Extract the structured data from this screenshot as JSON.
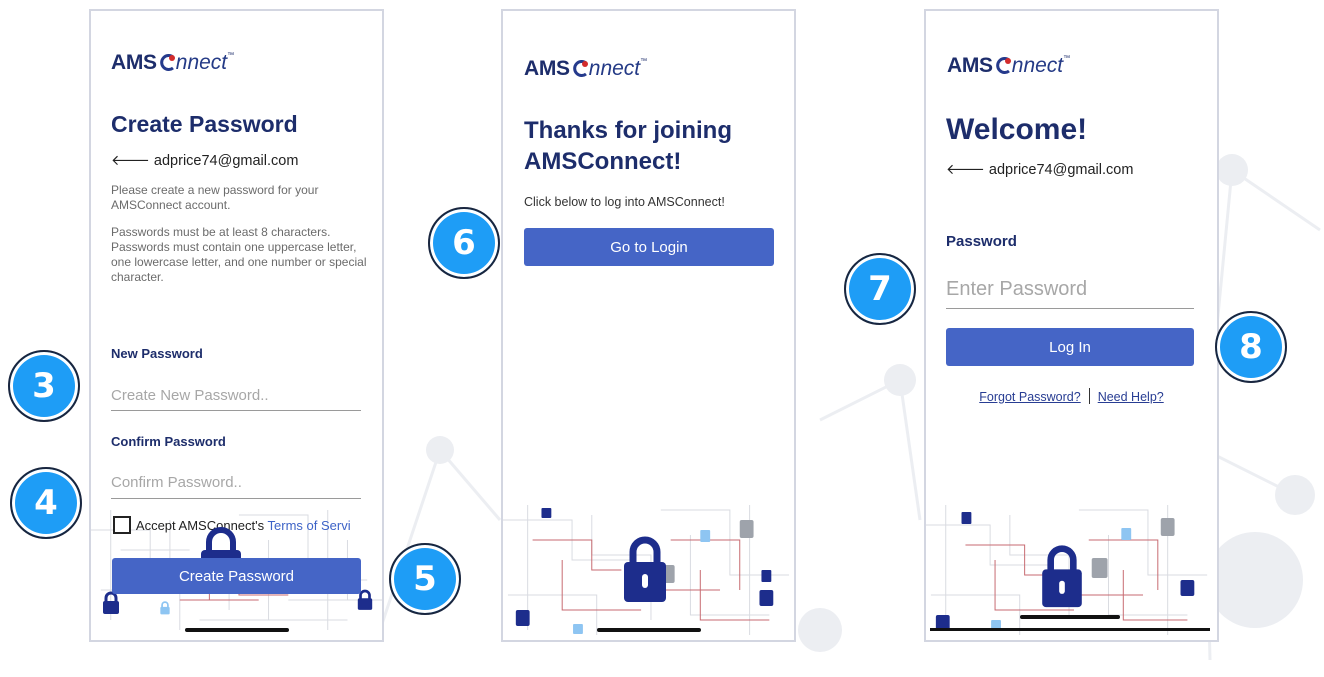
{
  "brand": {
    "bold": "AMS",
    "light": "nnect",
    "tm": "™"
  },
  "colors": {
    "primary_button": "#4565c6",
    "badge": "#1e9df6",
    "title": "#1d2d6b",
    "lock_navy": "#1d2d8c",
    "lock_blue": "#8ec5f2",
    "lock_gray": "#9ea3ab",
    "circuit_red": "#b5333b"
  },
  "screen1": {
    "title": "Create Password",
    "back_icon": "arrow-left-icon",
    "email": "adprice74@gmail.com",
    "intro": "Please create a new password for your AMSConnect account.",
    "rules": "Passwords must be at least 8 characters. Passwords must contain one uppercase letter, one lowercase letter, and one number or special character.",
    "new_password_label": "New Password",
    "new_password_placeholder": "Create New Password..",
    "confirm_password_label": "Confirm Password",
    "confirm_password_placeholder": "Confirm Password..",
    "terms_prefix": "Accept AMSConnect's",
    "terms_link": "Terms of Servi",
    "button": "Create Password"
  },
  "screen2": {
    "title_line1": "Thanks for joining",
    "title_line2": "AMSConnect!",
    "subtitle": "Click below to log into AMSConnect!",
    "button": "Go to Login"
  },
  "screen3": {
    "title": "Welcome!",
    "back_icon": "arrow-left-icon",
    "email": "adprice74@gmail.com",
    "password_label": "Password",
    "password_placeholder": "Enter Password",
    "button": "Log In",
    "forgot_link": "Forgot Password?",
    "help_link": "Need Help?"
  },
  "badges": {
    "b3": "3",
    "b4": "4",
    "b5": "5",
    "b6": "6",
    "b7": "7",
    "b8": "8"
  }
}
